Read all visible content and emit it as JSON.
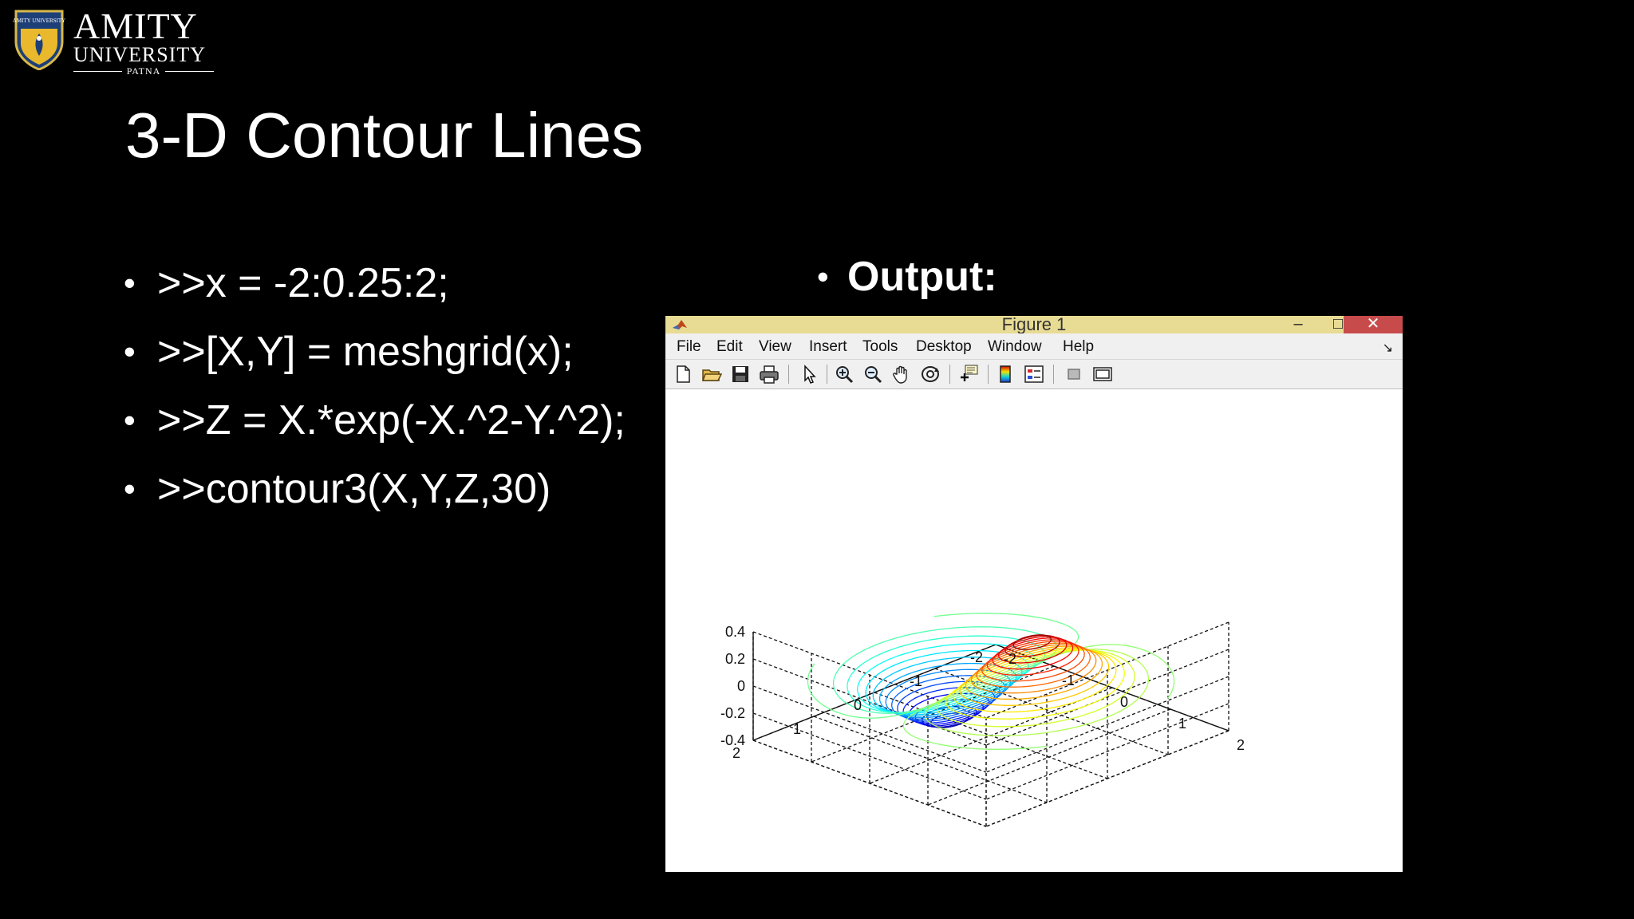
{
  "logo": {
    "name": "AMITY",
    "subtitle": "UNIVERSITY",
    "campus": "PATNA",
    "emblem_text": "AMITY UNIVERSITY"
  },
  "slide": {
    "title": "3-D Contour Lines",
    "code_lines": [
      ">>x = -2:0.25:2;",
      ">>[X,Y] = meshgrid(x);",
      ">>Z = X.*exp(-X.^2-Y.^2);",
      ">>contour3(X,Y,Z,30)"
    ],
    "output_label": "Output:"
  },
  "figure_window": {
    "title": "Figure 1",
    "controls": {
      "minimize": "–",
      "maximize": "□",
      "close": "✕"
    },
    "menu": [
      "File",
      "Edit",
      "View",
      "Insert",
      "Tools",
      "Desktop",
      "Window",
      "Help"
    ],
    "menu_dock": "↘",
    "toolbar": [
      "new-figure-icon",
      "open-file-icon",
      "save-figure-icon",
      "print-figure-icon",
      "edit-plot-arrow-icon",
      "zoom-in-icon",
      "zoom-out-icon",
      "pan-hand-icon",
      "rotate-3d-icon",
      "data-cursor-icon",
      "insert-colorbar-icon",
      "insert-legend-icon",
      "hide-plot-tools-icon",
      "show-plot-tools-icon"
    ]
  },
  "chart_data": {
    "type": "contour3",
    "title": "",
    "function": "Z = X.*exp(-X.^2-Y.^2)",
    "x_range": [
      -2,
      2
    ],
    "y_range": [
      -2,
      2
    ],
    "z_range": [
      -0.4,
      0.4
    ],
    "levels": 30,
    "colormap": "jet",
    "grid": true,
    "z_ticks": [
      "0.4",
      "0.2",
      "0",
      "-0.2",
      "-0.4"
    ],
    "x_ticks": [
      "-2",
      "-1",
      "0",
      "1",
      "2"
    ],
    "y_ticks": [
      "2",
      "1",
      "0",
      "-1",
      "-2"
    ]
  },
  "colors": {
    "background": "#000000",
    "titlebar": "#e8dc94",
    "close_button": "#c84b4b",
    "figure_background": "#c9c9c9",
    "axes_background": "#ffffff"
  }
}
